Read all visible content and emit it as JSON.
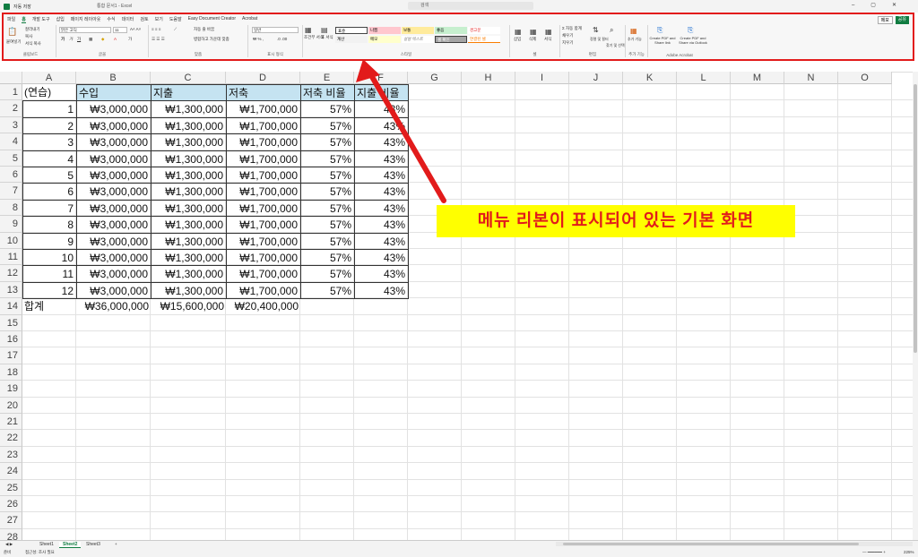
{
  "titlebar": {
    "autosave": "자동 저장",
    "doc_title": "통합 문서1 - Excel",
    "search_placeholder": "검색"
  },
  "ribbon": {
    "tabs": [
      "파일",
      "홈",
      "개발 도구",
      "삽입",
      "페이지 레이아웃",
      "수식",
      "데이터",
      "검토",
      "보기",
      "도움말",
      "Easy Document Creator",
      "Acrobat"
    ],
    "memo_label": "메모",
    "share_label": "공유",
    "groups": {
      "clipboard": "클립보드",
      "font": "글꼴",
      "alignment": "맞춤",
      "number": "표시 형식",
      "styles": "스타일",
      "cells": "셀",
      "editing": "편집",
      "addins": "추가 기능",
      "acrobat": "Adobe Acrobat"
    },
    "clipboard": {
      "paste": "붙여넣기",
      "cut": "잘라내기",
      "copy": "복사",
      "format_painter": "서식 복사"
    },
    "font": {
      "font_name": "맑은 고딕",
      "font_size": "11"
    },
    "alignment": {
      "wrap": "자동 줄 바꿈",
      "merge": "병합하고 가운데 맞춤"
    },
    "number": {
      "format": "일반"
    },
    "styles": {
      "conditional": "조건부 서식",
      "table": "표 서식",
      "cells": [
        {
          "label": "표준",
          "bg": "#ffffff"
        },
        {
          "label": "나쁨",
          "bg": "#ffc7ce"
        },
        {
          "label": "보통",
          "bg": "#ffeb9c"
        },
        {
          "label": "좋음",
          "bg": "#c6efce"
        },
        {
          "label": "경고문",
          "bg": "#ffffff"
        },
        {
          "label": "계산",
          "bg": "#f2f2f2"
        },
        {
          "label": "메모",
          "bg": "#ffffcc"
        },
        {
          "label": "설명 텍스트",
          "bg": "#ffffff"
        },
        {
          "label": "셀 확인",
          "bg": "#a5a5a5"
        },
        {
          "label": "연결된 셀",
          "bg": "#ffffff"
        }
      ]
    },
    "cells": {
      "insert": "삽입",
      "delete": "삭제",
      "format": "서식"
    },
    "editing": {
      "autosum": "자동 합계",
      "fill": "채우기",
      "clear": "지우기",
      "sort": "정렬 및 필터",
      "find": "찾기 및 선택"
    },
    "addins": {
      "label": "추가 기능"
    },
    "acrobat": {
      "create_pdf": "Create PDF and Share link",
      "create_outlook": "Create PDF and Share via Outlook"
    }
  },
  "columns": [
    "A",
    "B",
    "C",
    "D",
    "E",
    "F",
    "G",
    "H",
    "I",
    "J",
    "K",
    "L",
    "M",
    "N",
    "O"
  ],
  "row_numbers": [
    "1",
    "2",
    "3",
    "4",
    "5",
    "6",
    "7",
    "8",
    "9",
    "10",
    "11",
    "12",
    "13",
    "14",
    "15",
    "16",
    "17",
    "18",
    "19",
    "20",
    "21",
    "22",
    "23",
    "24",
    "25",
    "26",
    "27",
    "28"
  ],
  "table": {
    "headers": [
      "(연습)",
      "수입",
      "지출",
      "저축",
      "저축 비율",
      "지출 비율"
    ],
    "rows": [
      [
        "1",
        "₩3,000,000",
        "₩1,300,000",
        "₩1,700,000",
        "57%",
        "43%"
      ],
      [
        "2",
        "₩3,000,000",
        "₩1,300,000",
        "₩1,700,000",
        "57%",
        "43%"
      ],
      [
        "3",
        "₩3,000,000",
        "₩1,300,000",
        "₩1,700,000",
        "57%",
        "43%"
      ],
      [
        "4",
        "₩3,000,000",
        "₩1,300,000",
        "₩1,700,000",
        "57%",
        "43%"
      ],
      [
        "5",
        "₩3,000,000",
        "₩1,300,000",
        "₩1,700,000",
        "57%",
        "43%"
      ],
      [
        "6",
        "₩3,000,000",
        "₩1,300,000",
        "₩1,700,000",
        "57%",
        "43%"
      ],
      [
        "7",
        "₩3,000,000",
        "₩1,300,000",
        "₩1,700,000",
        "57%",
        "43%"
      ],
      [
        "8",
        "₩3,000,000",
        "₩1,300,000",
        "₩1,700,000",
        "57%",
        "43%"
      ],
      [
        "9",
        "₩3,000,000",
        "₩1,300,000",
        "₩1,700,000",
        "57%",
        "43%"
      ],
      [
        "10",
        "₩3,000,000",
        "₩1,300,000",
        "₩1,700,000",
        "57%",
        "43%"
      ],
      [
        "11",
        "₩3,000,000",
        "₩1,300,000",
        "₩1,700,000",
        "57%",
        "43%"
      ],
      [
        "12",
        "₩3,000,000",
        "₩1,300,000",
        "₩1,700,000",
        "57%",
        "43%"
      ]
    ],
    "total": [
      "합계",
      "₩36,000,000",
      "₩15,600,000",
      "₩20,400,000"
    ]
  },
  "callout": {
    "text": "메뉴 리본이 표시되어 있는 기본 화면",
    "color": "#e21b1b",
    "bg": "#ffff00"
  },
  "sheets": [
    "Sheet1",
    "Sheet2",
    "Sheet3"
  ],
  "active_sheet": "Sheet2",
  "status": {
    "ready": "준비",
    "accessibility": "접근성: 조사 필요",
    "zoom": "225%"
  },
  "colors": {
    "accent": "#107c41",
    "highlight_border": "#e21b1b",
    "header_fill": "#c5e3f1"
  }
}
